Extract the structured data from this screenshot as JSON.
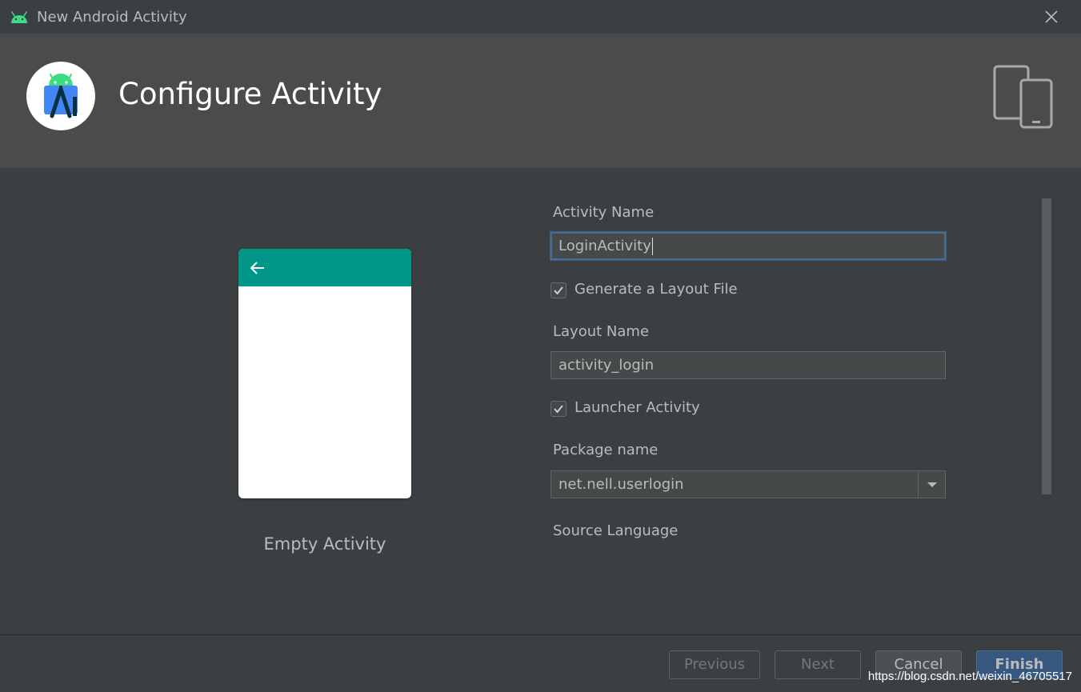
{
  "window": {
    "title": "New Android Activity",
    "app_icon": "android-icon",
    "close_icon": "close-icon"
  },
  "header": {
    "title": "Configure Activity",
    "logo_icon": "android-studio-logo",
    "device_icon": "devices-icon"
  },
  "preview": {
    "template_name": "Empty Activity",
    "back_icon": "arrow-left-icon",
    "toolbar_color": "#009688"
  },
  "form": {
    "activity_name_label": "Activity Name",
    "activity_name_value": "LoginActivity",
    "generate_layout_label": "Generate a Layout File",
    "generate_layout_checked": true,
    "layout_name_label": "Layout Name",
    "layout_name_value": "activity_login",
    "launcher_label": "Launcher Activity",
    "launcher_checked": true,
    "package_label": "Package name",
    "package_value": "net.nell.userlogin",
    "source_language_label": "Source Language"
  },
  "buttons": {
    "previous": "Previous",
    "next": "Next",
    "cancel": "Cancel",
    "finish": "Finish"
  },
  "watermark": "https://blog.csdn.net/weixin_46705517",
  "colors": {
    "accent": "#365880",
    "focus_border": "#466d94",
    "android_green": "#3ddc84"
  }
}
